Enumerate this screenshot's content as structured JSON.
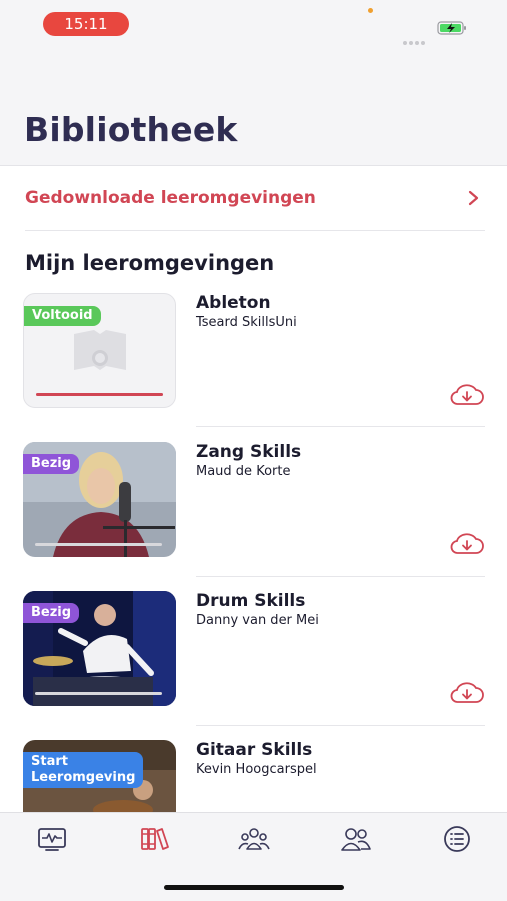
{
  "status": {
    "time": "15:11"
  },
  "header": {
    "title": "Bibliotheek"
  },
  "downloaded": {
    "label": "Gedownloade leeromgevingen"
  },
  "section": {
    "title": "Mijn leeromgevingen"
  },
  "courses": [
    {
      "title": "Ableton",
      "author": "Tseard SkillsUni",
      "badge": "Voltooid",
      "badge_color": "#5ac85a",
      "progress": 1.0
    },
    {
      "title": "Zang Skills",
      "author": "Maud de Korte",
      "badge": "Bezig",
      "badge_color": "#8f55d8",
      "progress": 0.0
    },
    {
      "title": "Drum Skills",
      "author": "Danny van der Mei",
      "badge": "Bezig",
      "badge_color": "#8f55d8",
      "progress": 0.0
    },
    {
      "title": "Gitaar Skills",
      "author": "Kevin Hoogcarspel",
      "badge_line1": "Start",
      "badge_line2": "Leeromgeving",
      "badge_color": "#3a82e6"
    }
  ],
  "tabs": [
    {
      "icon": "activity-icon",
      "active": false
    },
    {
      "icon": "library-icon",
      "active": true
    },
    {
      "icon": "group-icon",
      "active": false
    },
    {
      "icon": "people-icon",
      "active": false
    },
    {
      "icon": "list-icon",
      "active": false
    }
  ],
  "colors": {
    "accent": "#d14654",
    "title": "#2f2d52",
    "tab_inactive": "#3a3a5a"
  }
}
